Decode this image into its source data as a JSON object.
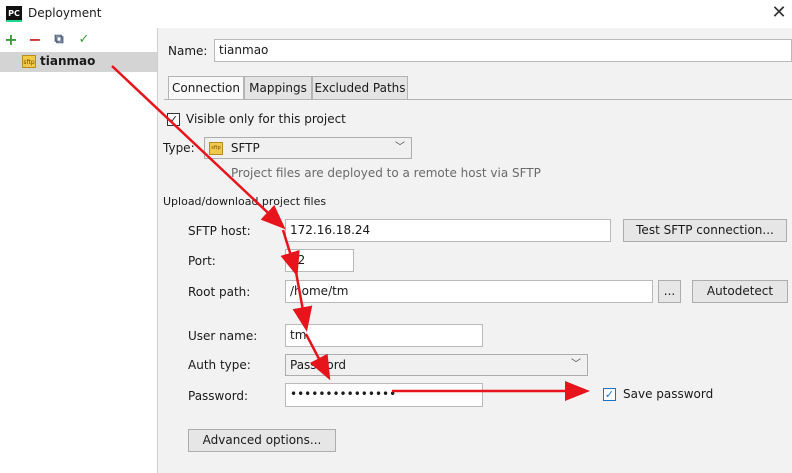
{
  "window": {
    "app_icon_text": "PC",
    "title": "Deployment",
    "close_glyph": "✕"
  },
  "toolbar": {
    "add_icon": "+",
    "remove_icon": "−",
    "copy_icon": "⧉",
    "check_icon": "✓"
  },
  "server": {
    "icon_text": "sftp",
    "name": "tianmao"
  },
  "name_field": {
    "label": "Name:",
    "value": "tianmao"
  },
  "tabs": [
    "Connection",
    "Mappings",
    "Excluded Paths"
  ],
  "visible_only": {
    "label": "Visible only for this project",
    "checked": true
  },
  "type": {
    "label": "Type:",
    "icon_text": "sftp",
    "value": "SFTP",
    "hint": "Project files are deployed to a remote host via SFTP"
  },
  "section": {
    "title": "Upload/download project files"
  },
  "sftp_host": {
    "label": "SFTP host:",
    "value": "172.16.18.24",
    "test_button": "Test SFTP connection..."
  },
  "port": {
    "label": "Port:",
    "value": "22"
  },
  "root_path": {
    "label": "Root path:",
    "value": "/home/tm",
    "browse_button": "...",
    "autodetect_button": "Autodetect"
  },
  "user_name": {
    "label": "User name:",
    "value": "tm"
  },
  "auth_type": {
    "label": "Auth type:",
    "value": "Password"
  },
  "password": {
    "label": "Password:",
    "value": "•••••••••••••••",
    "save_label": "Save password",
    "save_checked": true
  },
  "advanced_button": "Advanced options...",
  "colors": {
    "annotation_arrow": "#e8141c",
    "selection": "#d4d4d4",
    "checkbox_blue": "#1a73c9"
  }
}
